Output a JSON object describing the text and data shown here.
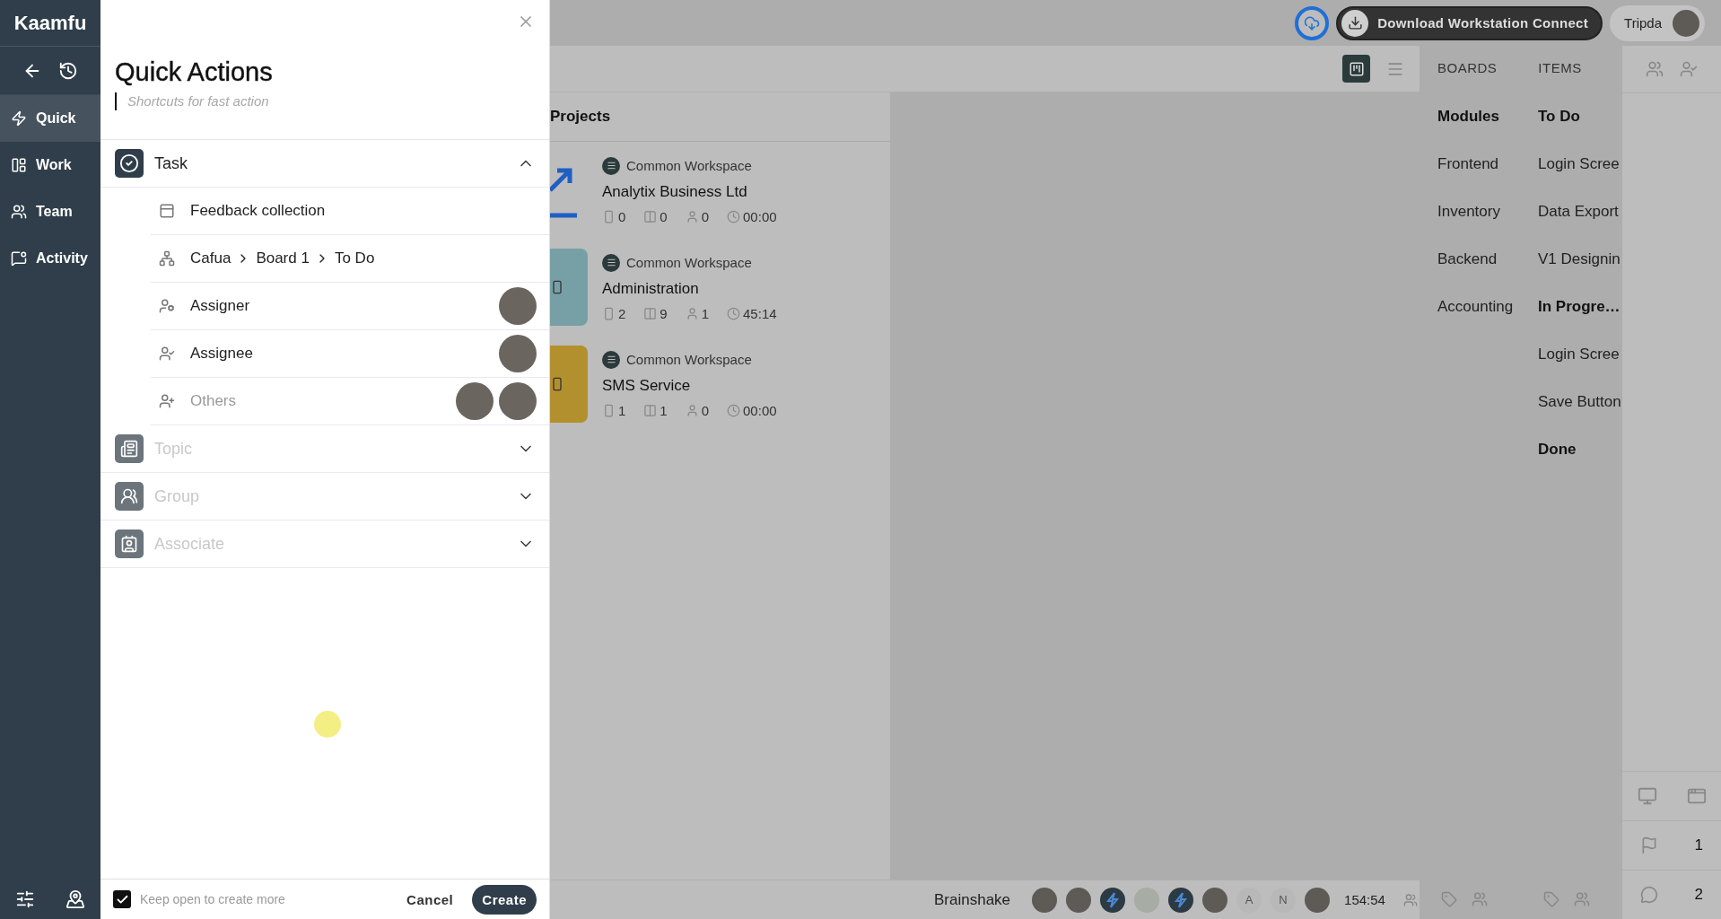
{
  "sidebar": {
    "logo": "Kaamfu",
    "nav": [
      {
        "label": "Quick",
        "selected": true
      },
      {
        "label": "Work",
        "selected": false
      },
      {
        "label": "Team",
        "selected": false
      },
      {
        "label": "Activity",
        "selected": false
      }
    ]
  },
  "quick_actions": {
    "title": "Quick Actions",
    "subtitle": "Shortcuts for fast action",
    "sections": [
      {
        "label": "Task",
        "expanded": true,
        "disabled": false,
        "fields": [
          {
            "kind": "title",
            "value": "Feedback collection"
          },
          {
            "kind": "path",
            "segments": [
              "Cafua",
              "Board 1",
              "To Do"
            ]
          },
          {
            "kind": "assigner",
            "label": "Assigner",
            "dimmed": false,
            "avatars": [
              {
                "kind": "photo"
              }
            ]
          },
          {
            "kind": "assignee",
            "label": "Assignee",
            "dimmed": false,
            "avatars": [
              {
                "kind": "photo"
              }
            ]
          },
          {
            "kind": "others",
            "label": "Others",
            "dimmed": true,
            "avatars": [
              {
                "kind": "photo"
              },
              {
                "kind": "photo"
              }
            ]
          }
        ]
      },
      {
        "label": "Topic",
        "expanded": false,
        "disabled": true
      },
      {
        "label": "Group",
        "expanded": false,
        "disabled": true
      },
      {
        "label": "Associate",
        "expanded": false,
        "disabled": true
      }
    ],
    "keep_open": {
      "label": "Keep open to create more",
      "checked": true
    },
    "buttons": [
      {
        "kind": "text",
        "label": "Cancel"
      },
      {
        "kind": "primary",
        "label": "Create"
      }
    ]
  },
  "top_bar": {
    "download": "Download Workstation Connect",
    "user": "Tripda"
  },
  "projects": {
    "title": "Projects",
    "items": [
      {
        "kind": "logo",
        "workspace": "Common Workspace",
        "name": "Analytix Business Ltd",
        "cards": "0",
        "boards": "0",
        "members": "0",
        "time": "00:00"
      },
      {
        "kind": "tile",
        "color": "#76a0a6",
        "workspace": "Common Workspace",
        "name": "Administration",
        "cards": "2",
        "boards": "9",
        "members": "1",
        "time": "45:14"
      },
      {
        "kind": "tile",
        "color": "#b3902e",
        "workspace": "Common Workspace",
        "name": "SMS Service",
        "cards": "1",
        "boards": "1",
        "members": "0",
        "time": "00:00"
      }
    ]
  },
  "boards_panel": {
    "tabs": [
      {
        "label": "BOARDS",
        "selected": false
      },
      {
        "label": "ITEMS",
        "selected": false
      }
    ],
    "modules_heading": "Modules",
    "modules": [
      "Frontend",
      "Inventory",
      "Backend",
      "Accounting"
    ],
    "items": [
      {
        "kind": "heading",
        "label": "To Do"
      },
      {
        "kind": "item",
        "label": "Login Scree"
      },
      {
        "kind": "item",
        "label": "Data Export"
      },
      {
        "kind": "item",
        "label": "V1 Designin"
      },
      {
        "kind": "heading",
        "label": "In Progre…"
      },
      {
        "kind": "item",
        "label": "Login Scree"
      },
      {
        "kind": "item",
        "label": "Save Button"
      },
      {
        "kind": "heading",
        "label": "Done"
      }
    ]
  },
  "status_bar": {
    "project": "Brainshake",
    "avatars": [
      {
        "kind": "photo"
      },
      {
        "kind": "photo"
      },
      {
        "kind": "logo"
      },
      {
        "kind": "faded"
      },
      {
        "kind": "logo"
      },
      {
        "kind": "photo"
      },
      {
        "kind": "letter",
        "text": "A"
      },
      {
        "kind": "letter",
        "text": "N"
      },
      {
        "kind": "photo"
      }
    ],
    "time": "154:54"
  },
  "right_rail": {
    "flags": "1",
    "comments": "2"
  }
}
